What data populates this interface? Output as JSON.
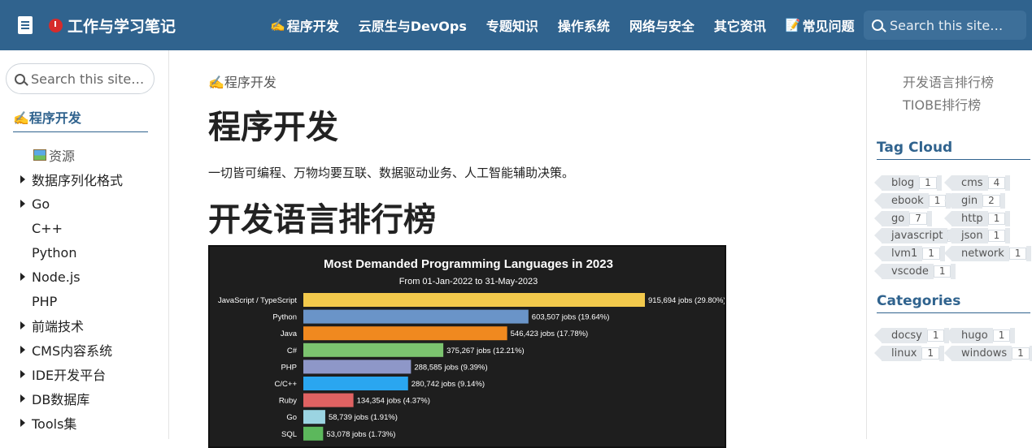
{
  "navbar": {
    "brand_title": "工作与学习笔记",
    "items": [
      {
        "emoji": "✍️",
        "label": "程序开发"
      },
      {
        "emoji": "",
        "label": "云原生与DevOps"
      },
      {
        "emoji": "",
        "label": "专题知识"
      },
      {
        "emoji": "",
        "label": "操作系统"
      },
      {
        "emoji": "",
        "label": "网络与安全"
      },
      {
        "emoji": "",
        "label": "其它资讯"
      },
      {
        "emoji": "📝",
        "label": "常见问题"
      }
    ],
    "search_placeholder": "Search this site…"
  },
  "sidebar": {
    "search_placeholder": "Search this site…",
    "section_emoji": "✍️",
    "section_label": "程序开发",
    "items": [
      {
        "label": "资源",
        "caret": false,
        "sub": true,
        "icon": "image-icon"
      },
      {
        "label": "数据序列化格式",
        "caret": true
      },
      {
        "label": "Go",
        "caret": true
      },
      {
        "label": "C++",
        "caret": false
      },
      {
        "label": "Python",
        "caret": false
      },
      {
        "label": "Node.js",
        "caret": true
      },
      {
        "label": "PHP",
        "caret": false
      },
      {
        "label": "前端技术",
        "caret": true
      },
      {
        "label": "CMS内容系统",
        "caret": true
      },
      {
        "label": "IDE开发平台",
        "caret": true
      },
      {
        "label": "DB数据库",
        "caret": true
      },
      {
        "label": "Tools集",
        "caret": true
      }
    ]
  },
  "main": {
    "breadcrumb_emoji": "✍️",
    "breadcrumb": "程序开发",
    "title": "程序开发",
    "lead": "一切皆可编程、万物均要互联、数据驱动业务、人工智能辅助决策。",
    "h2": "开发语言排行榜"
  },
  "chart_data": {
    "type": "bar",
    "orientation": "horizontal",
    "title": "Most Demanded Programming Languages in 2023",
    "subtitle": "From 01-Jan-2022 to 31-May-2023",
    "categories": [
      "JavaScript / TypeScript",
      "Python",
      "Java",
      "C#",
      "PHP",
      "C/C++",
      "Ruby",
      "Go",
      "SQL"
    ],
    "values": [
      915694,
      603507,
      546423,
      375267,
      288585,
      280742,
      134354,
      58739,
      53078
    ],
    "labels": [
      "915,694 jobs (29.80%)",
      "603,507 jobs (19.64%)",
      "546,423 jobs (17.78%)",
      "375,267 jobs (12.21%)",
      "288,585 jobs (9.39%)",
      "280,742 jobs (9.14%)",
      "134,354 jobs (4.37%)",
      "58,739 jobs (1.91%)",
      "53,078 jobs (1.73%)"
    ],
    "colors": [
      "#f2c94c",
      "#6a94c8",
      "#f0891f",
      "#7cc46f",
      "#8e97c8",
      "#2aa6f0",
      "#e06262",
      "#9bd4e2",
      "#5cb85c"
    ],
    "background": "#1e1e1e",
    "xlim": [
      0,
      915694
    ]
  },
  "toc": {
    "links": [
      "开发语言排行榜",
      "TIOBE排行榜"
    ],
    "tag_cloud_title": "Tag Cloud",
    "tags": [
      {
        "name": "blog",
        "count": "1"
      },
      {
        "name": "cms",
        "count": "4"
      },
      {
        "name": "ebook",
        "count": "1"
      },
      {
        "name": "gin",
        "count": "2"
      },
      {
        "name": "go",
        "count": "7"
      },
      {
        "name": "http",
        "count": "1"
      },
      {
        "name": "javascript",
        "count": "1"
      },
      {
        "name": "json",
        "count": "1"
      },
      {
        "name": "lvm1",
        "count": "1"
      },
      {
        "name": "network",
        "count": "1"
      },
      {
        "name": "vscode",
        "count": "1"
      }
    ],
    "categories_title": "Categories",
    "categories": [
      {
        "name": "docsy",
        "count": "1"
      },
      {
        "name": "hugo",
        "count": "1"
      },
      {
        "name": "linux",
        "count": "1"
      },
      {
        "name": "windows",
        "count": "1"
      }
    ]
  }
}
